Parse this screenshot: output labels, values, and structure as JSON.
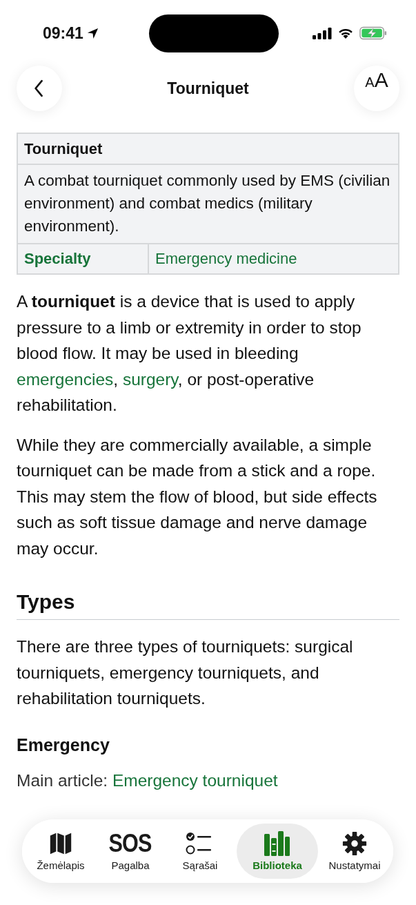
{
  "status_bar": {
    "time": "09:41"
  },
  "nav": {
    "title": "Tourniquet",
    "text_size_button": "AA"
  },
  "infobox": {
    "title": "Tourniquet",
    "caption": "A combat tourniquet commonly used by EMS (civilian environment) and combat medics (military environment).",
    "rows": [
      {
        "label": "Specialty",
        "value": "Emergency medicine"
      }
    ]
  },
  "content": [
    {
      "kind": "paragraph",
      "parts": [
        {
          "kind": "text",
          "text": "A **tourniquet** is a device that is used to apply pressure to a limb or extremity in order to stop blood flow. It may be used in bleeding "
        },
        {
          "kind": "link",
          "text": "emergencies"
        },
        {
          "kind": "text",
          "text": ", "
        },
        {
          "kind": "link",
          "text": "surgery"
        },
        {
          "kind": "text",
          "text": ", or post-operative rehabilitation."
        }
      ]
    },
    {
      "kind": "paragraph",
      "parts": [
        {
          "kind": "text",
          "text": "While they are commercially available, a simple tourniquet can be made from a stick and a rope. This may stem the flow of blood, but side effects such as soft tissue damage and nerve damage may occur."
        }
      ]
    },
    {
      "kind": "heading",
      "text": "Types"
    },
    {
      "kind": "paragraph",
      "parts": [
        {
          "kind": "text",
          "text": "There are three types of tourniquets: surgical tourniquets, emergency tourniquets, and rehabilitation tourniquets."
        }
      ]
    },
    {
      "kind": "subheading",
      "text": "Emergency"
    },
    {
      "kind": "hatnote",
      "parts": [
        {
          "kind": "text",
          "text": "Main article: "
        },
        {
          "kind": "link",
          "text": "Emergency tourniquet"
        }
      ]
    }
  ],
  "tab_bar": [
    {
      "label": "Žemėlapis",
      "selected": false
    },
    {
      "label": "Pagalba",
      "glyph": "SOS",
      "selected": false
    },
    {
      "label": "Sąrašai",
      "selected": false
    },
    {
      "label": "Biblioteka",
      "selected": true
    },
    {
      "label": "Nustatymai",
      "selected": false
    }
  ]
}
